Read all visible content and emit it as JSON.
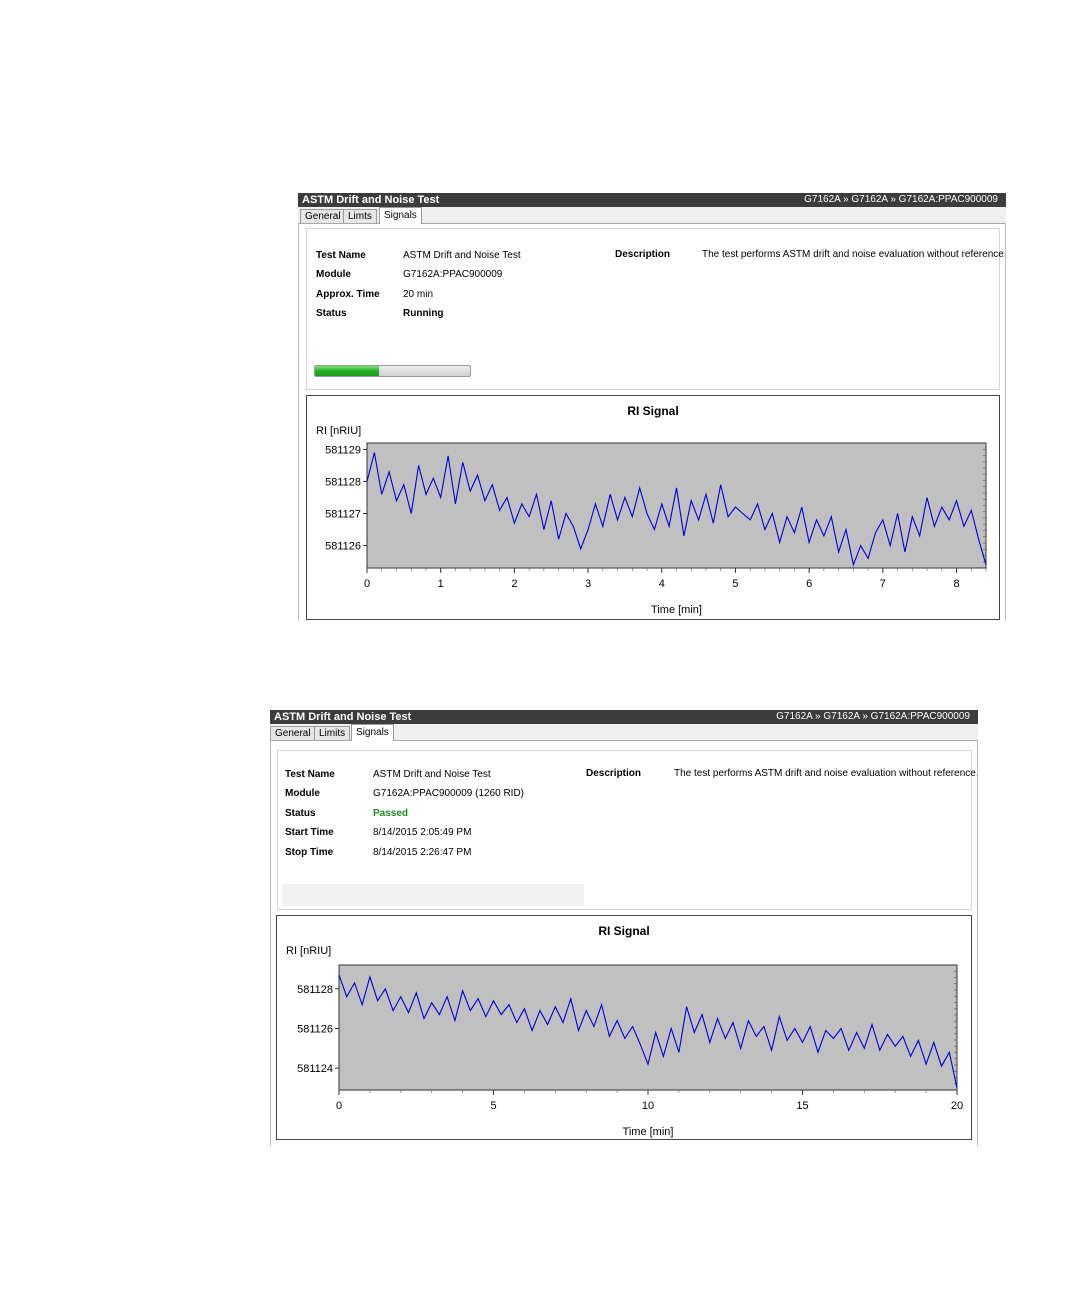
{
  "panels": [
    {
      "title": "ASTM Drift and Noise Test",
      "breadcrumb": "G7162A » G7162A » G7162A:PPAC900009",
      "tabs": [
        "General",
        "Limts",
        "Signals"
      ],
      "active_tab": "Signals",
      "fields": [
        {
          "label": "Test Name",
          "value": "ASTM Drift and Noise Test"
        },
        {
          "label": "Module",
          "value": "G7162A:PPAC900009"
        },
        {
          "label": "Approx. Time",
          "value": "20 min"
        },
        {
          "label": "Status",
          "value": "Running"
        }
      ],
      "description_label": "Description",
      "description": "The test performs ASTM drift and noise evaluation without reference.",
      "progress": 0.41
    },
    {
      "title": "ASTM Drift and Noise Test",
      "breadcrumb": "G7162A » G7162A » G7162A:PPAC900009",
      "tabs": [
        "General",
        "Limits",
        "Signals"
      ],
      "active_tab": "Signals",
      "fields": [
        {
          "label": "Test Name",
          "value": "ASTM Drift and Noise Test"
        },
        {
          "label": "Module",
          "value": "G7162A:PPAC900009 (1260 RID)"
        },
        {
          "label": "Status",
          "value": "Passed"
        },
        {
          "label": "Start Time",
          "value": "8/14/2015 2:05:49 PM"
        },
        {
          "label": "Stop Time",
          "value": "8/14/2015 2:26:47 PM"
        }
      ],
      "description_label": "Description",
      "description": "The test performs ASTM drift and noise evaluation without reference."
    }
  ],
  "colors": {
    "title_bar": "#3c3c3c",
    "plot_bg": "#c0c0c0",
    "line": "#0000e0",
    "passed": "#1f8b1f",
    "progress": "#26b126"
  },
  "chart_data": [
    {
      "type": "line",
      "title": "RI Signal",
      "ylabel": "RI [nRIU]",
      "xlabel": "Time [min]",
      "xlim": [
        0,
        8.4
      ],
      "ylim": [
        581125.3,
        581129.2
      ],
      "xticks": [
        0,
        1,
        2,
        3,
        4,
        5,
        6,
        7,
        8
      ],
      "yticks": [
        581126,
        581127,
        581128,
        581129
      ],
      "grid": false,
      "series": [
        {
          "x": [
            0,
            0.1,
            0.2,
            0.3,
            0.4,
            0.5,
            0.6,
            0.7,
            0.8,
            0.9,
            1.0,
            1.1,
            1.2,
            1.3,
            1.4,
            1.5,
            1.6,
            1.7,
            1.8,
            1.9,
            2.0,
            2.1,
            2.2,
            2.3,
            2.4,
            2.5,
            2.6,
            2.7,
            2.8,
            2.9,
            3.0,
            3.1,
            3.2,
            3.3,
            3.4,
            3.5,
            3.6,
            3.7,
            3.8,
            3.9,
            4.0,
            4.1,
            4.2,
            4.3,
            4.4,
            4.5,
            4.6,
            4.7,
            4.8,
            4.9,
            5.0,
            5.1,
            5.2,
            5.3,
            5.4,
            5.5,
            5.6,
            5.7,
            5.8,
            5.9,
            6.0,
            6.1,
            6.2,
            6.3,
            6.4,
            6.5,
            6.6,
            6.7,
            6.8,
            6.9,
            7.0,
            7.1,
            7.2,
            7.3,
            7.4,
            7.5,
            7.6,
            7.7,
            7.8,
            7.9,
            8.0,
            8.1,
            8.2,
            8.3,
            8.4
          ],
          "y": [
            581128.0,
            581128.9,
            581127.6,
            581128.3,
            581127.4,
            581127.9,
            581127.0,
            581128.5,
            581127.6,
            581128.1,
            581127.5,
            581128.8,
            581127.3,
            581128.6,
            581127.7,
            581128.2,
            581127.4,
            581127.9,
            581127.1,
            581127.5,
            581126.7,
            581127.3,
            581126.9,
            581127.6,
            581126.5,
            581127.4,
            581126.2,
            581127.0,
            581126.6,
            581125.9,
            581126.5,
            581127.3,
            581126.6,
            581127.6,
            581126.8,
            581127.5,
            581126.9,
            581127.8,
            581127.0,
            581126.5,
            581127.3,
            581126.6,
            581127.8,
            581126.3,
            581127.4,
            581126.8,
            581127.6,
            581126.7,
            581127.9,
            581126.9,
            581127.2,
            581127.0,
            581126.8,
            581127.3,
            581126.5,
            581127.0,
            581126.1,
            581126.9,
            581126.4,
            581127.2,
            581126.1,
            581126.8,
            581126.3,
            581126.9,
            581125.8,
            581126.5,
            581125.4,
            581126.0,
            581125.6,
            581126.4,
            581126.8,
            581126.0,
            581127.0,
            581125.8,
            581126.9,
            581126.3,
            581127.5,
            581126.6,
            581127.2,
            581126.8,
            581127.4,
            581126.6,
            581127.1,
            581126.2,
            581125.4
          ]
        }
      ]
    },
    {
      "type": "line",
      "title": "RI Signal",
      "ylabel": "RI [nRIU]",
      "xlabel": "Time [min]",
      "xlim": [
        0,
        20
      ],
      "ylim": [
        581122.9,
        581129.2
      ],
      "xticks": [
        0,
        5,
        10,
        15,
        20
      ],
      "yticks": [
        581124,
        581126,
        581128
      ],
      "grid": false,
      "series": [
        {
          "x": [
            0,
            0.25,
            0.5,
            0.75,
            1.0,
            1.25,
            1.5,
            1.75,
            2.0,
            2.25,
            2.5,
            2.75,
            3.0,
            3.25,
            3.5,
            3.75,
            4.0,
            4.25,
            4.5,
            4.75,
            5.0,
            5.25,
            5.5,
            5.75,
            6.0,
            6.25,
            6.5,
            6.75,
            7.0,
            7.25,
            7.5,
            7.75,
            8.0,
            8.25,
            8.5,
            8.75,
            9.0,
            9.25,
            9.5,
            9.75,
            10.0,
            10.25,
            10.5,
            10.75,
            11.0,
            11.25,
            11.5,
            11.75,
            12.0,
            12.25,
            12.5,
            12.75,
            13.0,
            13.25,
            13.5,
            13.75,
            14.0,
            14.25,
            14.5,
            14.75,
            15.0,
            15.25,
            15.5,
            15.75,
            16.0,
            16.25,
            16.5,
            16.75,
            17.0,
            17.25,
            17.5,
            17.75,
            18.0,
            18.25,
            18.5,
            18.75,
            19.0,
            19.25,
            19.5,
            19.75,
            20.0
          ],
          "y": [
            581128.7,
            581127.6,
            581128.3,
            581127.2,
            581128.6,
            581127.4,
            581128.0,
            581126.9,
            581127.6,
            581126.8,
            581127.8,
            581126.5,
            581127.3,
            581126.7,
            581127.6,
            581126.4,
            581127.9,
            581126.9,
            581127.5,
            581126.6,
            581127.4,
            581126.7,
            581127.2,
            581126.3,
            581127.0,
            581125.9,
            581126.9,
            581126.2,
            581127.1,
            581126.3,
            581127.5,
            581125.9,
            581126.9,
            581126.1,
            581127.2,
            581125.6,
            581126.4,
            581125.5,
            581126.1,
            581125.2,
            581124.2,
            581125.8,
            581124.6,
            581126.0,
            581124.8,
            581127.1,
            581125.8,
            581126.7,
            581125.3,
            581126.5,
            581125.5,
            581126.3,
            581125.0,
            581126.4,
            581125.6,
            581126.1,
            581124.9,
            581126.6,
            581125.4,
            581126.0,
            581125.3,
            581126.1,
            581124.8,
            581125.9,
            581125.5,
            581126.0,
            581124.9,
            581125.8,
            581125.0,
            581126.2,
            581124.9,
            581125.7,
            581125.1,
            581125.6,
            581124.6,
            581125.4,
            581124.2,
            581125.3,
            581124.1,
            581124.8,
            581123.0
          ]
        }
      ]
    }
  ]
}
